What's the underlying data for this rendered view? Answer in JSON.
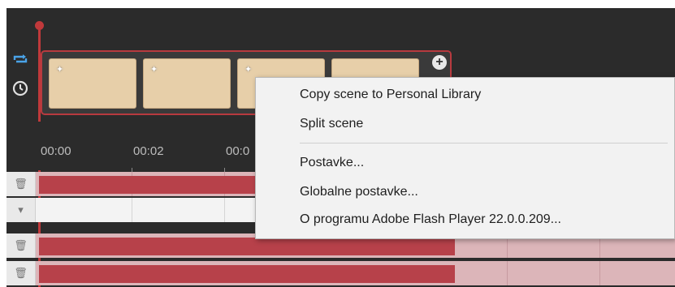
{
  "timeline": {
    "time_labels": [
      "00:00",
      "00:02",
      "00:0"
    ]
  },
  "scenes": [
    "scene-1",
    "scene-2",
    "scene-3",
    "scene-4"
  ],
  "context_menu": {
    "items": [
      "Copy scene to Personal Library",
      "Split scene",
      "Postavke...",
      "Globalne postavke...",
      "O programu Adobe Flash Player 22.0.0.209..."
    ]
  },
  "icons": {
    "loop": "loop-icon",
    "clock": "clock-icon",
    "trash": "trash-icon",
    "collapse": "chevron-down-icon",
    "add": "add-scene-icon"
  },
  "colors": {
    "accent": "#c0393b",
    "panel": "#2b2b2b",
    "bar": "#b7414a",
    "menu_bg": "#f2f2f2"
  }
}
